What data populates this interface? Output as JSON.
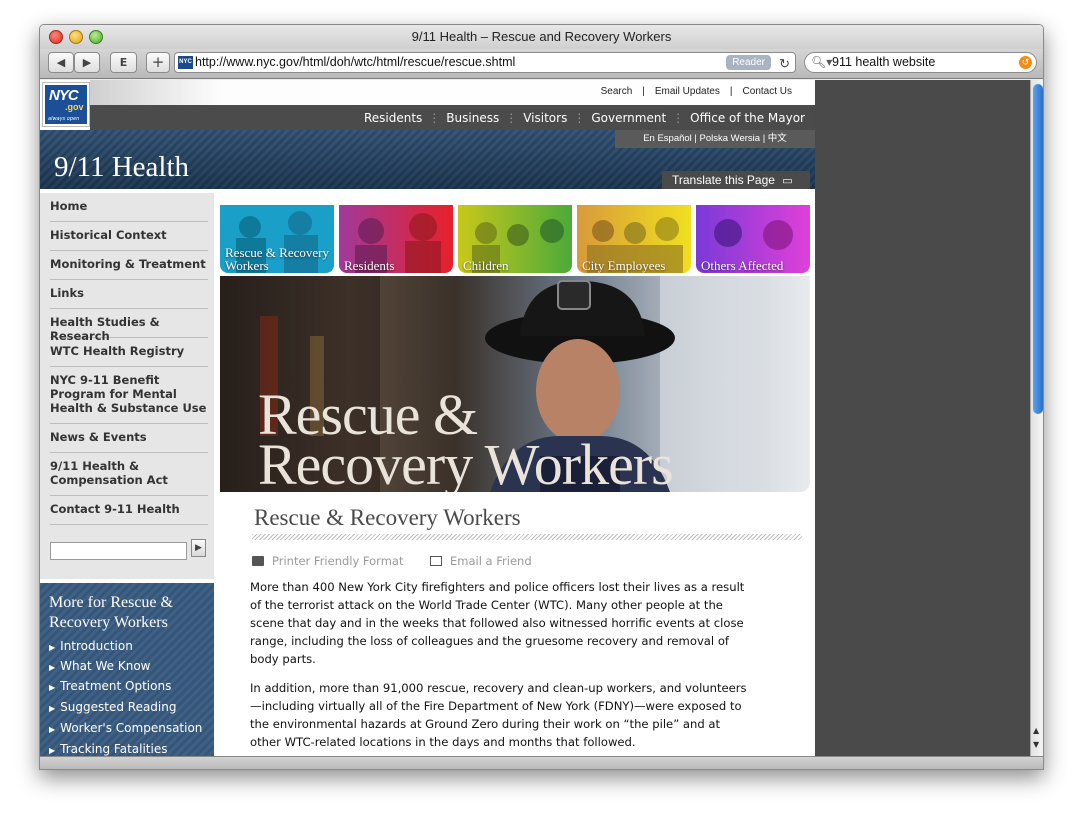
{
  "window": {
    "title": "9/11 Health – Rescue and Recovery Workers"
  },
  "toolbar": {
    "back_icon": "back-arrow",
    "forward_icon": "forward-arrow",
    "add_icon": "plus",
    "url": "http://www.nyc.gov/html/doh/wtc/html/rescue/rescue.shtml",
    "reader_label": "Reader",
    "search_value": "911 health website"
  },
  "site": {
    "logo_text": "NYC",
    "logo_suffix": ".gov",
    "logo_tagline": "always open",
    "util_links": [
      "Search",
      "|",
      "Email Updates",
      "|",
      "Contact Us"
    ],
    "nav": [
      "Residents",
      "Business",
      "Visitors",
      "Government",
      "Office of the Mayor"
    ],
    "lang_links": "En Español  |  Polska Wersia  |  中文",
    "title": "9/11 Health",
    "translate_label": "Translate this Page"
  },
  "leftnav": {
    "items": [
      "Home",
      "Historical Context",
      "Monitoring & Treatment",
      "Links",
      "Health Studies & Research",
      "WTC Health Registry",
      "NYC 9-11 Benefit Program for Mental Health & Substance Use",
      "News & Events",
      "9/11 Health & Compensation Act",
      "Contact 9-11 Health"
    ]
  },
  "more": {
    "title": "More for Rescue & Recovery Workers",
    "links": [
      "Introduction",
      "What We Know",
      "Treatment Options",
      "Suggested Reading",
      "Worker's Compensation",
      "Tracking Fatalities"
    ]
  },
  "tiles": [
    {
      "label": "Rescue & Recovery Workers",
      "color": "#1aa0c8"
    },
    {
      "label": "Residents",
      "color": "#e0245e"
    },
    {
      "label": "Children",
      "color": "#8cc23a"
    },
    {
      "label": "City Employees",
      "color": "#f0c020"
    },
    {
      "label": "Others Affected",
      "color": "#b040d0"
    }
  ],
  "hero": {
    "line1": "Rescue &",
    "line2": "Recovery Workers"
  },
  "content": {
    "heading": "Rescue & Recovery Workers",
    "printer_label": "Printer Friendly Format",
    "email_label": "Email a Friend",
    "para1": "More than 400 New York City firefighters and police officers lost their lives as a result of the terrorist attack on the World Trade Center (WTC).  Many other people at the scene that day and in the weeks that followed also witnessed horrific events at close range, including the loss of colleagues and the gruesome recovery and removal of body parts.",
    "para2": "In addition, more than 91,000 rescue, recovery and clean-up workers, and volunteers —including virtually all of the Fire Department of New York (FDNY)—were exposed to the environmental hazards at Ground Zero during their work on “the pile” and at other WTC-related locations in the days and months that followed."
  }
}
